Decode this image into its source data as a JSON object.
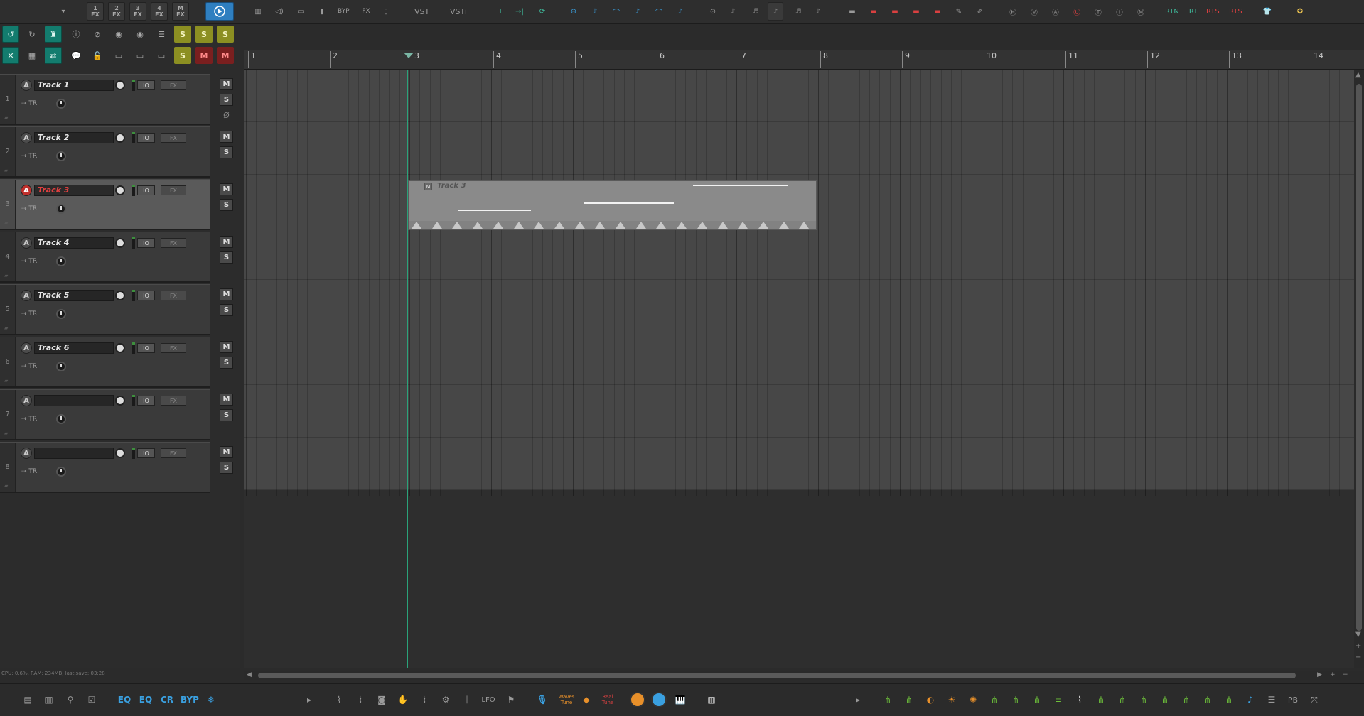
{
  "toolbar": {
    "fx_buttons": [
      {
        "num": "1",
        "label": "FX"
      },
      {
        "num": "2",
        "label": "FX"
      },
      {
        "num": "3",
        "label": "FX"
      },
      {
        "num": "4",
        "label": "FX"
      },
      {
        "num": "M",
        "label": "FX"
      }
    ],
    "byp_label": "BYP",
    "fx_label": "FX",
    "vst_label": "VST",
    "vsti_label": "VSTi",
    "rtn_label": "RTN",
    "rt_label": "RT",
    "rts_label": "RTS",
    "rts2_label": "RTS"
  },
  "tcp": {
    "route_label": "TR",
    "io_label": "IO",
    "fx_label": "FX",
    "mute_label": "M",
    "solo_label": "S",
    "phase_symbol": "Ø",
    "rec_label": "A",
    "tracks": [
      {
        "num": "1",
        "name": "Track 1",
        "selected": false
      },
      {
        "num": "2",
        "name": "Track 2",
        "selected": false
      },
      {
        "num": "3",
        "name": "Track 3",
        "selected": true
      },
      {
        "num": "4",
        "name": "Track 4",
        "selected": false
      },
      {
        "num": "5",
        "name": "Track 5",
        "selected": false
      },
      {
        "num": "6",
        "name": "Track 6",
        "selected": false
      },
      {
        "num": "7",
        "name": "",
        "selected": false
      },
      {
        "num": "8",
        "name": "",
        "selected": false
      }
    ]
  },
  "status": {
    "text": "CPU: 0.6%, RAM: 234MB, last save: 03:28"
  },
  "ruler": {
    "marks": [
      "1",
      "2",
      "3",
      "4",
      "5",
      "6",
      "7",
      "8",
      "9",
      "10",
      "11",
      "12",
      "13",
      "14"
    ]
  },
  "item": {
    "title": "Track 3",
    "mute_label": "M"
  },
  "bottombar": {
    "eq1": "EQ",
    "eq2": "EQ",
    "cr": "CR",
    "byp": "BYP",
    "lfo": "LFO",
    "waves_tune": "Waves Tune",
    "real_tune": "Real Tune",
    "pb": "PB"
  },
  "colors": {
    "accent_blue": "#2f7fc0",
    "teal": "#137c6e",
    "cursor": "#2aa37a",
    "selected_track_name": "#e04040",
    "item_bg": "#8a8a8a"
  }
}
